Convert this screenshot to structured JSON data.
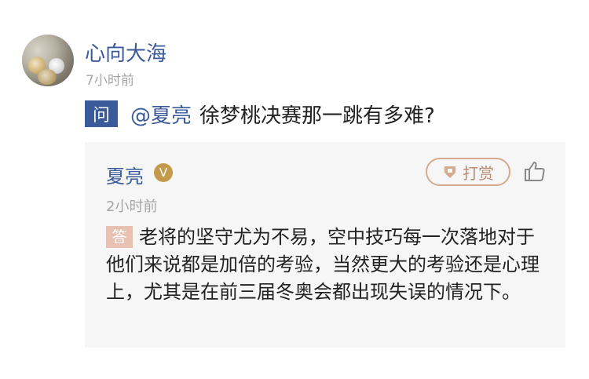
{
  "post": {
    "author": "心向大海",
    "time": "7小时前"
  },
  "question": {
    "badge": "问",
    "mention": "@夏亮",
    "text": "徐梦桃决赛那一跳有多难?"
  },
  "answer": {
    "author": "夏亮",
    "verified_badge": "V",
    "time": "2小时前",
    "tip_label": "打赏",
    "badge": "答",
    "text": "老将的坚守尤为不易，空中技巧每一次落地对于他们来说都是加倍的考验，当然更大的考验还是心理上，尤其是在前三届冬奥会都出现失误的情况下。"
  },
  "icons": {
    "tip": "coin-tag-icon",
    "like": "thumbs-up-icon"
  },
  "colors": {
    "accent": "#3a5a99",
    "tip_border": "#d6aa8f",
    "answer_badge": "#e8c1b3",
    "card_bg": "#f6f6f6"
  }
}
